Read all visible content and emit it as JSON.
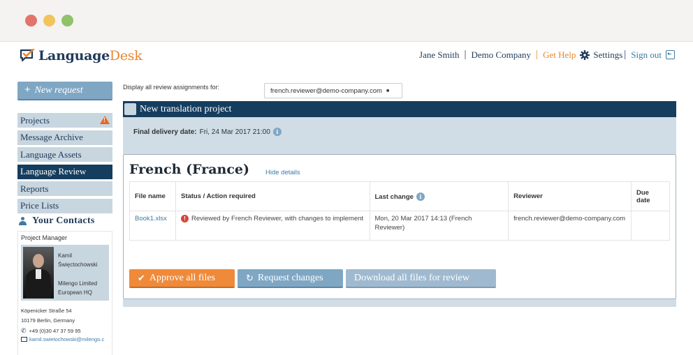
{
  "app": {
    "logo_part1": "Language",
    "logo_part2": "Desk"
  },
  "topnav": {
    "user": "Jane Smith",
    "company": "Demo Company",
    "help": "Get Help",
    "settings": "Settings",
    "signout": "Sign out"
  },
  "sidebar": {
    "new_request": "New request",
    "menu": [
      {
        "label": "Projects"
      },
      {
        "label": "Message Archive"
      },
      {
        "label": "Language Assets"
      },
      {
        "label": "Language Review"
      },
      {
        "label": "Reports"
      },
      {
        "label": "Price Lists"
      }
    ],
    "contacts_title": "Your Contacts",
    "pm_label": "Project Manager",
    "pm_name": "Kamil Święctochowski",
    "pm_company": "Milengo Limited European HQ",
    "address_line1": "Köpenicker Straße 54",
    "address_line2": "10179 Berlin, Germany",
    "phone": "+49 (0)30 47 37 59 95",
    "email": "kamil.swietochowski@milengo.c"
  },
  "filter": {
    "label": "Display all review assignments for:",
    "selected": "french.reviewer@demo-company.com"
  },
  "project": {
    "title": "New translation project",
    "delivery_label": "Final delivery date:",
    "delivery_value": "Fri, 24 Mar 2017 21:00",
    "language": "French (France)",
    "hide_details": "Hide details",
    "columns": {
      "file": "File name",
      "status": "Status / Action required",
      "last_change": "Last change",
      "reviewer": "Reviewer",
      "due": "Due date"
    },
    "rows": [
      {
        "file": "Book1.xlsx",
        "status": "Reviewed by French Reviewer, with changes to implement",
        "last_change": "Mon, 20 Mar 2017 14:13 (French Reviewer)",
        "reviewer": "french.reviewer@demo-company.com",
        "due": ""
      }
    ],
    "actions": {
      "approve": "Approve all files",
      "request_changes": "Request changes",
      "download": "Download all files for review"
    }
  },
  "colors": {
    "navy": "#153d5e",
    "orange": "#e8872e",
    "light_blue": "#c8d6e0"
  }
}
